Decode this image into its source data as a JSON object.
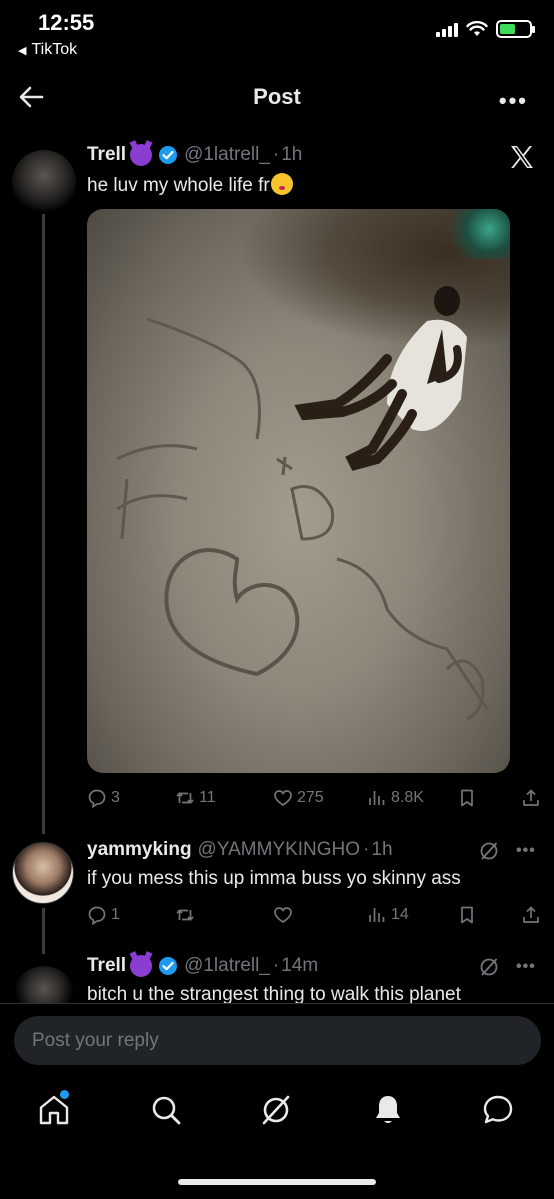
{
  "status_bar": {
    "time": "12:55",
    "back_app": "TikTok",
    "battery_color": "#3ddc5a"
  },
  "header": {
    "title": "Post",
    "back_icon": "arrow-left-icon",
    "more_icon": "more-horizontal-icon"
  },
  "main_tweet": {
    "name": "Trell",
    "handle": "@1latrell_",
    "time": "1h",
    "text": "he luv my whole life fr",
    "replies": "3",
    "reposts": "11",
    "likes": "275",
    "views": "8.8K"
  },
  "reply_1": {
    "name": "yammyking",
    "handle": "@YAMMYKINGHO",
    "time": "1h",
    "text": "if you mess this up imma buss yo skinny ass",
    "replies": "1",
    "reposts": "",
    "likes": "",
    "views": "14"
  },
  "reply_2": {
    "name": "Trell",
    "handle": "@1latrell_",
    "time": "14m",
    "text": "bitch u the strangest thing to walk this planet"
  },
  "reply_input": {
    "placeholder": "Post your reply",
    "value": ""
  },
  "colors": {
    "background": "#000000",
    "text": "#e7e9ea",
    "muted": "#71767b",
    "accent": "#1d9bf0",
    "input_bg": "#202327"
  },
  "tabs": [
    "home-icon",
    "search-icon",
    "grok-icon",
    "notifications-icon",
    "messages-icon"
  ]
}
